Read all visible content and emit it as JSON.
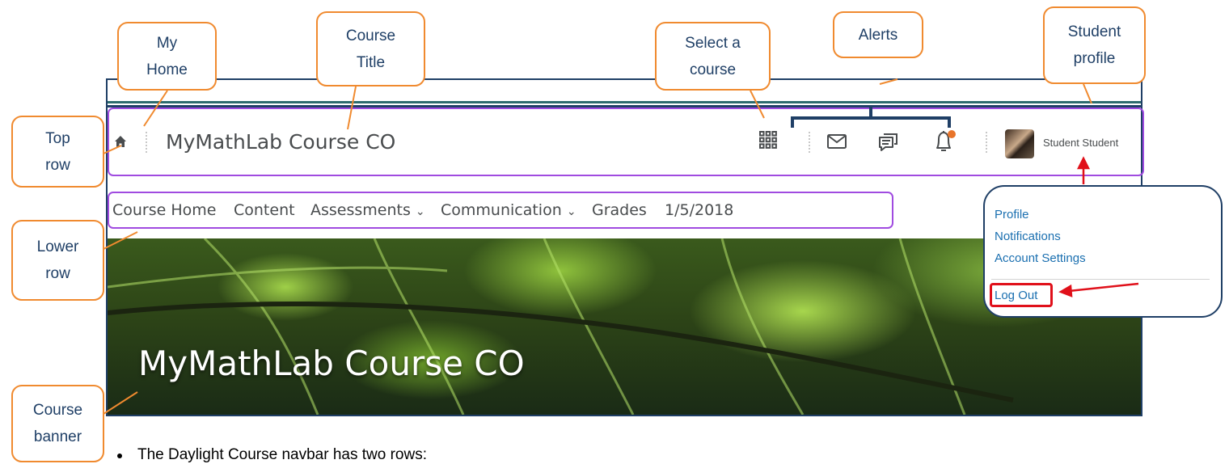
{
  "course_window": {
    "course_title": "MyMathLab Course CO",
    "user_name": "Student Student",
    "menu": [
      {
        "label": "Course Home"
      },
      {
        "label": "Content"
      },
      {
        "label": "Assessments",
        "has_dropdown": true
      },
      {
        "label": "Communication",
        "has_dropdown": true
      },
      {
        "label": "Grades"
      },
      {
        "label": "1/5/2018"
      }
    ],
    "banner_title": "MyMathLab Course CO",
    "icons": [
      "home-icon",
      "course-selector-icon",
      "mail-icon",
      "chat-icon",
      "bell-icon"
    ],
    "notification_dot_color": "#e8742a"
  },
  "profile_menu": {
    "items": [
      "Profile",
      "Notifications",
      "Account Settings"
    ],
    "logout": "Log Out"
  },
  "annotations": {
    "my_home": [
      "My",
      "Home"
    ],
    "course_title": [
      "Course",
      "Title"
    ],
    "select_course": [
      "Select a",
      "course"
    ],
    "alerts": [
      "Alerts"
    ],
    "student_profile": [
      "Student",
      "profile"
    ],
    "top_row": [
      "Top",
      "row"
    ],
    "lower_row": [
      "Lower",
      "row"
    ],
    "course_banner": [
      "Course",
      "banner"
    ]
  },
  "colors": {
    "callout_border": "#f08a2f",
    "callout_text": "#1f3f66",
    "row_highlight": "#a04be0",
    "logout_highlight": "#e0101a",
    "link": "#1a6fb0"
  },
  "footer_text": "The Daylight Course navbar has two rows:"
}
